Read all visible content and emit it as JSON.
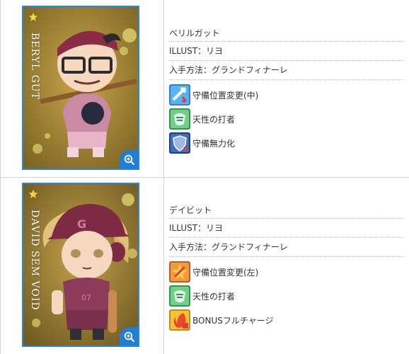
{
  "cards": [
    {
      "vertical_name": "BERYL GUT",
      "name": "ベリルガット",
      "illust": "ILLUST：リヨ",
      "obtain": "入手方法：グランドフィナーレ",
      "skills": [
        {
          "icon": "defense-shift-icon",
          "label": "守備位置変更(中)"
        },
        {
          "icon": "natural-hitter-icon",
          "label": "天性の打者"
        },
        {
          "icon": "defense-nullify-icon",
          "label": "守備無力化"
        }
      ]
    },
    {
      "vertical_name": "DAVID SEM VOID",
      "name": "デイビット",
      "illust": "ILLUST：リヨ",
      "obtain": "入手方法：グランドフィナーレ",
      "skills": [
        {
          "icon": "defense-shift-left-icon",
          "label": "守備位置変更(左)"
        },
        {
          "icon": "natural-hitter-icon",
          "label": "天性の打者"
        },
        {
          "icon": "bonus-full-charge-icon",
          "label": "BONUSフルチャージ"
        }
      ]
    }
  ],
  "colors": {
    "border": "#d7d7d7",
    "card_frame": "#2b86d6",
    "zoom_badge": "#1f7fd8"
  }
}
